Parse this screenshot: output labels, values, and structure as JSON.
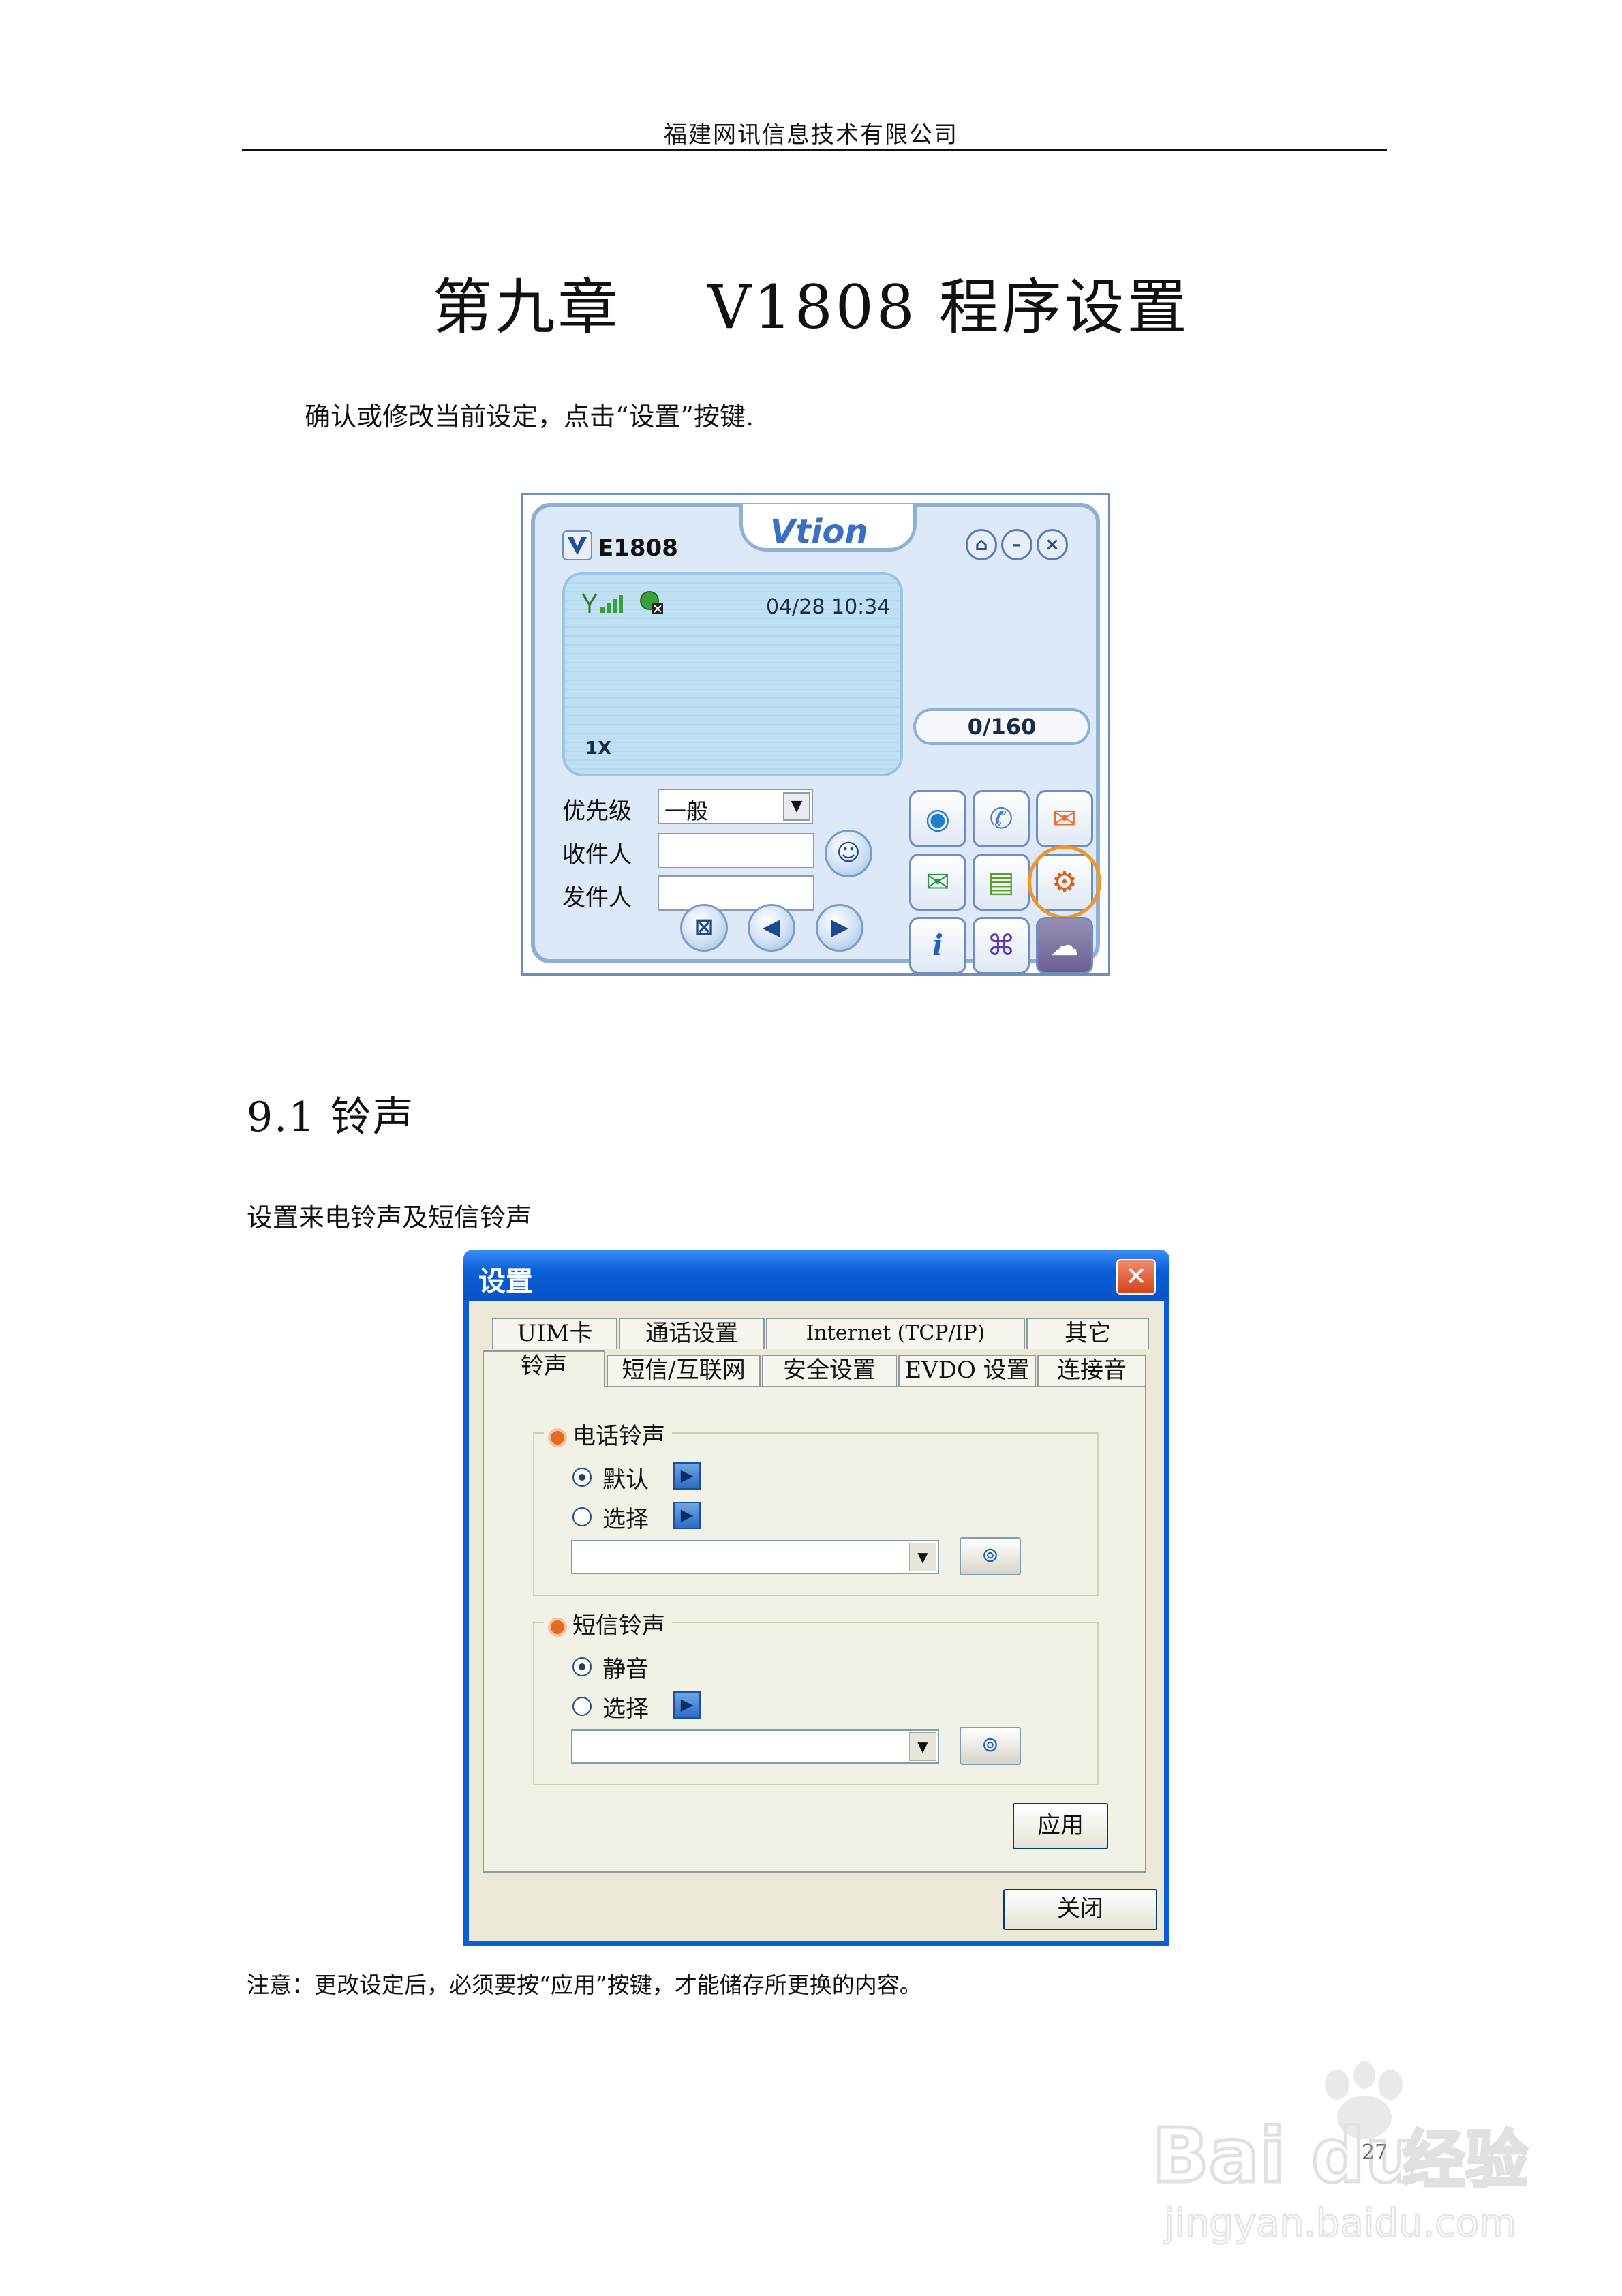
{
  "page": {
    "header": "福建网讯信息技术有限公司",
    "chapter_title": "第九章    V1808 程序设置",
    "intro": "确认或修改当前设定，点击“设置”按键.",
    "section_title": "9.1 铃声",
    "section_desc": "设置来电铃声及短信铃声",
    "note": "注意：更改设定后，必须要按“应用”按键，才能储存所更换的内容。",
    "page_number": "27"
  },
  "device": {
    "logo": "Vtion",
    "title": "E1808",
    "datetime": "04/28 10:34",
    "network": "1X",
    "sms_counter": "0/160",
    "priority_label": "优先级",
    "priority_value": "一般",
    "recipient_label": "收件人",
    "sender_label": "发件人",
    "accent_color": "#3a6fc4",
    "highlight_color": "#f1962a",
    "icons": [
      "antenna-signal-icon",
      "sim-status-icon",
      "lock-icon",
      "minimize-icon",
      "close-icon",
      "contacts-icon",
      "delete-icon",
      "back-icon",
      "forward-icon",
      "internet-icon",
      "phone-icon",
      "send-mail-icon",
      "receive-mail-icon",
      "phonebook-icon",
      "settings-icon",
      "info-icon",
      "unicom-icon",
      "network-icon"
    ]
  },
  "dialog": {
    "title": "设置",
    "tabs_row1": [
      "UIM卡",
      "通话设置",
      "Internet (TCP/IP)",
      "其它"
    ],
    "tabs_row2": [
      "铃声",
      "短信/互联网",
      "安全设置",
      "EVDO 设置",
      "连接音"
    ],
    "active_tab": "铃声",
    "call_group": {
      "title": "电话铃声",
      "options": [
        "默认",
        "选择"
      ],
      "selected": "默认",
      "combo_value": ""
    },
    "sms_group": {
      "title": "短信铃声",
      "options": [
        "静音",
        "选择"
      ],
      "selected": "静音",
      "combo_value": ""
    },
    "apply_label": "应用",
    "close_label": "关闭",
    "titlebar_color": "#0a5fd8",
    "body_color": "#ece9d8"
  },
  "watermark": {
    "brand": "Bai du 经验",
    "url": "jingyan.baidu.com"
  }
}
